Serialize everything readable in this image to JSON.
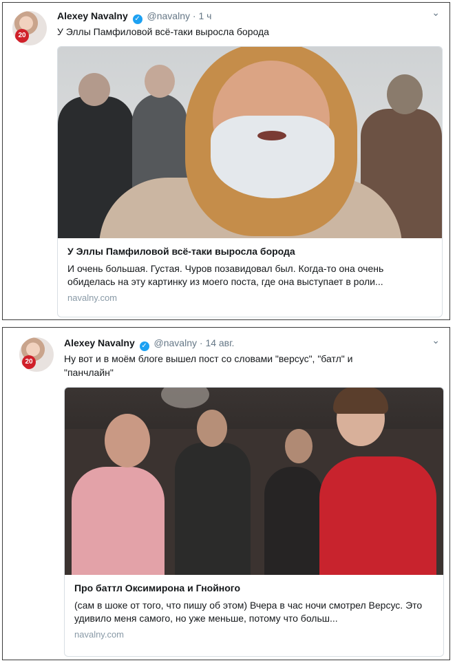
{
  "tweets": [
    {
      "author": "Alexey Navalny",
      "handle": "@navalny",
      "separator": "·",
      "time": "1 ч",
      "avatar_badge": "20",
      "text": "У Эллы Памфиловой всё-таки выросла борода",
      "card": {
        "title": "У Эллы Памфиловой всё-таки выросла борода",
        "description": "И очень большая. Густая. Чуров позавидовал был. Когда-то она очень обиделась на эту картинку из моего поста, где она выступает в роли...",
        "domain": "navalny.com"
      }
    },
    {
      "author": "Alexey Navalny",
      "handle": "@navalny",
      "separator": "·",
      "time": "14 авг.",
      "avatar_badge": "20",
      "text": "Ну вот и в моём блоге вышел пост со словами \"версус\", \"батл\" и \"панчлайн\"",
      "card": {
        "title": "Про баттл Оксимирона и Гнойного",
        "description": "(сам в шоке от того, что пишу об этом) Вчера в час ночи смотрел Версус. Это удивило меня самого, но уже меньше, потому что больш...",
        "domain": "navalny.com"
      }
    }
  ],
  "icons": {
    "verified": "✓",
    "menu": "⌄"
  },
  "colors": {
    "verified": "#1da1f2",
    "muted": "#657786",
    "domain": "#8899a6"
  }
}
